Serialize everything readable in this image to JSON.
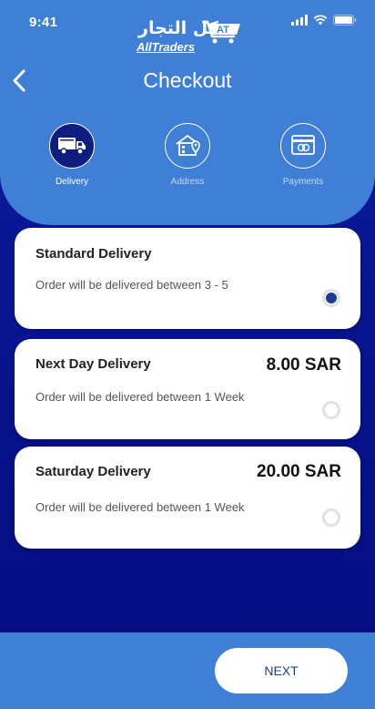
{
  "status_bar": {
    "time": "9:41"
  },
  "logo": {
    "arabic_text": "كل التجار",
    "english_text": "AllTraders",
    "badge": "AT"
  },
  "header": {
    "title": "Checkout"
  },
  "steps": [
    {
      "label": "Delivery",
      "icon": "truck-icon",
      "active": true
    },
    {
      "label": "Address",
      "icon": "address-icon",
      "active": false
    },
    {
      "label": "Payments",
      "icon": "payment-card-icon",
      "active": false
    }
  ],
  "delivery_options": [
    {
      "title": "Standard Delivery",
      "price": "",
      "description": "Order will be delivered between 3 - 5",
      "selected": true
    },
    {
      "title": "Next Day Delivery",
      "price": "8.00 SAR",
      "description": "Order will be delivered between 1 Week",
      "selected": false
    },
    {
      "title": "Saturday Delivery",
      "price": "20.00 SAR",
      "description": "Order will be delivered between 1 Week",
      "selected": false
    }
  ],
  "footer": {
    "next_label": "NEXT"
  },
  "colors": {
    "header_blue": "#3f7fd5",
    "background_navy": "#060f86",
    "accent": "#1f3b94"
  }
}
